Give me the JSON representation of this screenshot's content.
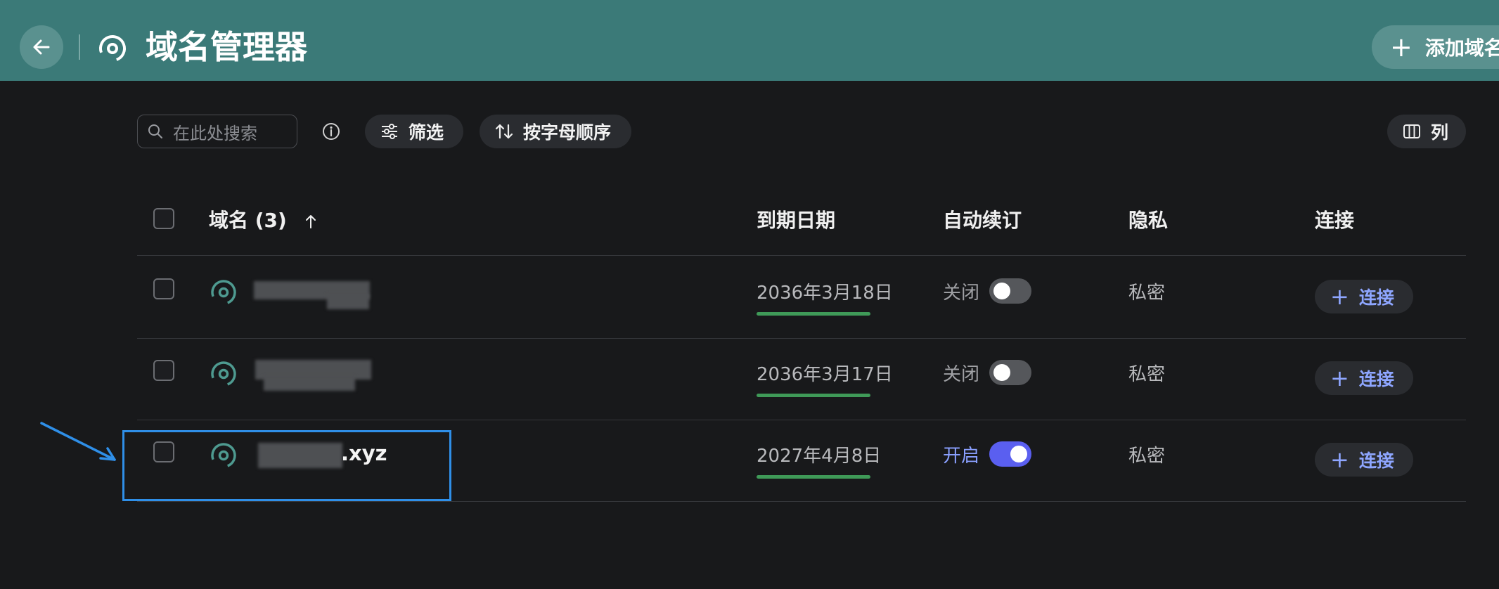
{
  "header": {
    "title": "域名管理器",
    "add_button_label": "添加域名"
  },
  "toolbar": {
    "search_placeholder": "在此处搜索",
    "filter_label": "筛选",
    "sort_label": "按字母顺序",
    "columns_label": "列"
  },
  "table": {
    "columns": {
      "domain": "域名 (3)",
      "expiry": "到期日期",
      "auto_renew": "自动续订",
      "privacy": "隐私",
      "connect": "连接"
    },
    "rows": [
      {
        "domain": "",
        "expiry": "2036年3月18日",
        "auto_renew_label": "关闭",
        "auto_renew_on": false,
        "privacy": "私密",
        "connect_label": "连接"
      },
      {
        "domain": "",
        "expiry": "2036年3月17日",
        "auto_renew_label": "关闭",
        "auto_renew_on": false,
        "privacy": "私密",
        "connect_label": "连接"
      },
      {
        "domain": ".xyz",
        "expiry": "2027年4月8日",
        "auto_renew_label": "开启",
        "auto_renew_on": true,
        "privacy": "私密",
        "connect_label": "连接"
      }
    ]
  },
  "colors": {
    "header_bg": "#3b7a78",
    "page_bg": "#18191b",
    "accent_blue": "#5a5ff0",
    "link_blue": "#8ea6ff",
    "expiry_bar": "#3f9a58",
    "annotation": "#2f8fe8"
  },
  "icons": {
    "back": "arrow-left-icon",
    "domain": "target-circle-icon",
    "search": "search-icon",
    "info": "info-icon",
    "filter": "sliders-icon",
    "sort": "sort-arrows-icon",
    "columns": "columns-icon",
    "sort_asc": "arrow-up-icon"
  }
}
